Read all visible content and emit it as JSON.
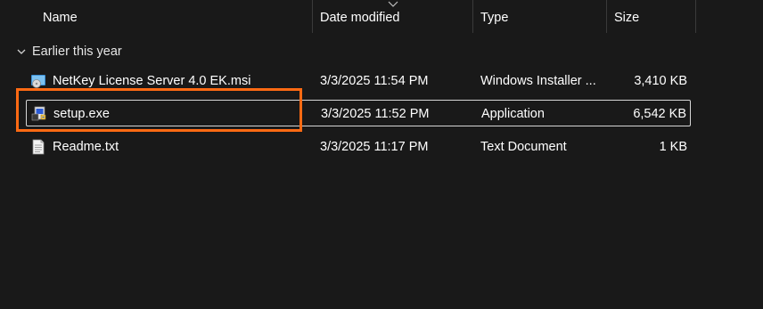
{
  "columns": {
    "name": "Name",
    "date_modified": "Date modified",
    "type": "Type",
    "size": "Size"
  },
  "group": {
    "label": "Earlier this year"
  },
  "files": [
    {
      "name": "NetKey License Server 4.0 EK.msi",
      "date_modified": "3/3/2025 11:54 PM",
      "type": "Windows Installer ...",
      "size": "3,410 KB",
      "icon": "msi-installer-icon"
    },
    {
      "name": "setup.exe",
      "date_modified": "3/3/2025 11:52 PM",
      "type": "Application",
      "size": "6,542 KB",
      "icon": "setup-exe-icon",
      "selected": true
    },
    {
      "name": "Readme.txt",
      "date_modified": "3/3/2025 11:17 PM",
      "type": "Text Document",
      "size": "1 KB",
      "icon": "text-document-icon"
    }
  ],
  "colors": {
    "background": "#191919",
    "highlight": "#ff6a13",
    "selection_border": "#d6d6d6"
  }
}
